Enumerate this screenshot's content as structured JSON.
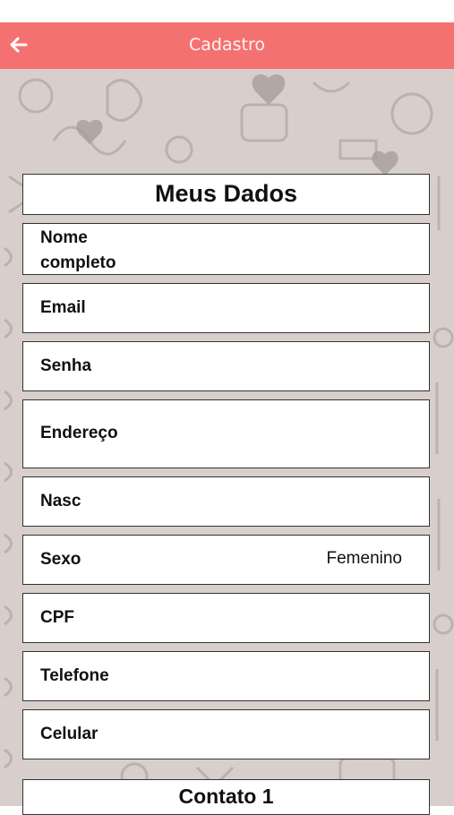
{
  "nav": {
    "title": "Cadastro",
    "back_icon": "arrow-left-icon",
    "bg_color": "#f47171"
  },
  "form": {
    "heading": "Meus Dados",
    "fields": [
      {
        "label": "Nome\ncompleto",
        "value": ""
      },
      {
        "label": "Email",
        "value": ""
      },
      {
        "label": "Senha",
        "value": ""
      },
      {
        "label": "Endereço",
        "value": ""
      },
      {
        "label": "Nasc",
        "value": ""
      },
      {
        "label": "Sexo",
        "value": "Femenino"
      },
      {
        "label": "CPF",
        "value": ""
      },
      {
        "label": "Telefone",
        "value": ""
      },
      {
        "label": "Celular",
        "value": ""
      }
    ],
    "next_section": "Contato 1"
  }
}
